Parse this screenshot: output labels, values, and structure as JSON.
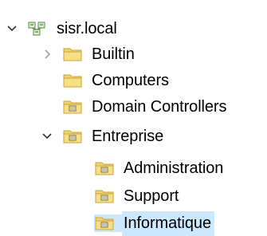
{
  "tree": {
    "root": {
      "label": "sisr.local",
      "expanded": true,
      "icon": "domain-icon"
    },
    "items": [
      {
        "label": "Builtin",
        "type": "container",
        "expandable": true,
        "expanded": false,
        "icon": "folder-icon"
      },
      {
        "label": "Computers",
        "type": "container",
        "expandable": false,
        "icon": "folder-icon"
      },
      {
        "label": "Domain Controllers",
        "type": "ou",
        "expandable": false,
        "icon": "ou-folder-icon"
      },
      {
        "label": "Entreprise",
        "type": "ou",
        "expandable": true,
        "expanded": true,
        "icon": "ou-folder-icon",
        "children": [
          {
            "label": "Administration",
            "type": "ou",
            "icon": "ou-folder-icon"
          },
          {
            "label": "Support",
            "type": "ou",
            "icon": "ou-folder-icon"
          },
          {
            "label": "Informatique",
            "type": "ou",
            "icon": "ou-folder-icon",
            "selected": true
          }
        ]
      }
    ]
  },
  "colors": {
    "selection": "#cce8ff",
    "folder": "#f3d36b",
    "folder_edge": "#c9a43c",
    "chevron_expanded": "#333333",
    "chevron_collapsed": "#a0a0a0"
  }
}
